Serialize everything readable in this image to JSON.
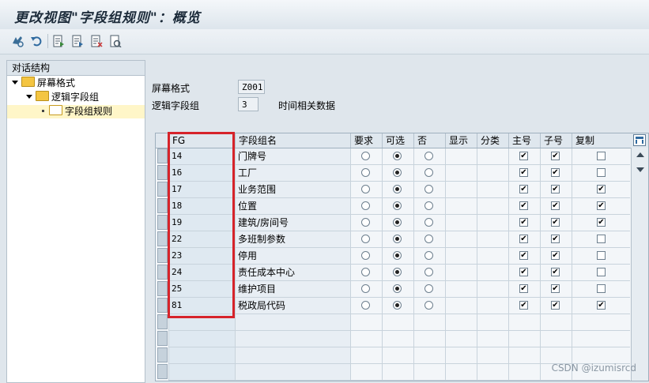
{
  "window": {
    "title": "更改视图\"字段组规则\"：概览"
  },
  "toolbar": {
    "icons": [
      "display-change-icon",
      "undo-icon",
      "new-entries-icon",
      "copy-as-icon",
      "delete-icon",
      "select-all-icon"
    ]
  },
  "tree": {
    "header": "对话结构",
    "items": [
      {
        "label": "屏幕格式",
        "level": 0,
        "expanded": true
      },
      {
        "label": "逻辑字段组",
        "level": 1,
        "expanded": true
      },
      {
        "label": "字段组规则",
        "level": 2,
        "selected": true
      }
    ]
  },
  "form": {
    "screen_format_label": "屏幕格式",
    "screen_format_value": "Z001",
    "logical_group_label": "逻辑字段组",
    "logical_group_value": "3",
    "logical_group_desc": "时间相关数据"
  },
  "table": {
    "columns": [
      "FG",
      "字段组名",
      "要求",
      "可选",
      "否",
      "显示",
      "分类",
      "主号",
      "子号",
      "复制"
    ],
    "rows": [
      {
        "fg": "14",
        "name": "门牌号",
        "required": false,
        "optional": true,
        "no": false,
        "main": true,
        "sub": true,
        "copy": false
      },
      {
        "fg": "16",
        "name": "工厂",
        "required": false,
        "optional": true,
        "no": false,
        "main": true,
        "sub": true,
        "copy": false
      },
      {
        "fg": "17",
        "name": "业务范围",
        "required": false,
        "optional": true,
        "no": false,
        "main": true,
        "sub": true,
        "copy": true
      },
      {
        "fg": "18",
        "name": "位置",
        "required": false,
        "optional": true,
        "no": false,
        "main": true,
        "sub": true,
        "copy": true
      },
      {
        "fg": "19",
        "name": "建筑/房间号",
        "required": false,
        "optional": true,
        "no": false,
        "main": true,
        "sub": true,
        "copy": true
      },
      {
        "fg": "22",
        "name": "多班制参数",
        "required": false,
        "optional": true,
        "no": false,
        "main": true,
        "sub": true,
        "copy": false
      },
      {
        "fg": "23",
        "name": "停用",
        "required": false,
        "optional": true,
        "no": false,
        "main": true,
        "sub": true,
        "copy": false
      },
      {
        "fg": "24",
        "name": "责任成本中心",
        "required": false,
        "optional": true,
        "no": false,
        "main": true,
        "sub": true,
        "copy": false
      },
      {
        "fg": "25",
        "name": "维护项目",
        "required": false,
        "optional": true,
        "no": false,
        "main": true,
        "sub": true,
        "copy": false
      },
      {
        "fg": "81",
        "name": "税政局代码",
        "required": false,
        "optional": true,
        "no": false,
        "main": true,
        "sub": true,
        "copy": true
      }
    ],
    "empty_rows": 4
  },
  "watermark": "CSDN @izumisrcd",
  "colors": {
    "highlight_box": "#d6232a",
    "selected_tree": "#fff6c8"
  }
}
